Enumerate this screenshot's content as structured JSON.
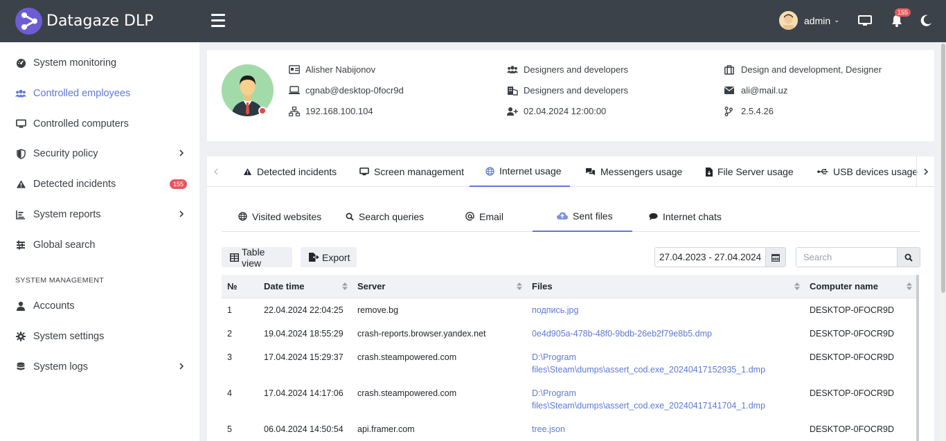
{
  "app": {
    "title": "Datagaze DLP",
    "user_name": "admin",
    "notification_count": "155"
  },
  "sidebar": {
    "items": [
      {
        "label": "System monitoring",
        "icon": "gauge-icon"
      },
      {
        "label": "Controlled employees",
        "icon": "users-icon",
        "active": true
      },
      {
        "label": "Controlled computers",
        "icon": "monitor-icon"
      },
      {
        "label": "Security policy",
        "icon": "shield-icon",
        "has_children": true
      },
      {
        "label": "Detected incidents",
        "icon": "warning-icon",
        "badge": "155"
      },
      {
        "label": "System reports",
        "icon": "chart-icon",
        "has_children": true
      },
      {
        "label": "Global search",
        "icon": "sliders-icon"
      }
    ],
    "section_title": "SYSTEM MANAGEMENT",
    "management_items": [
      {
        "label": "Accounts",
        "icon": "user-icon"
      },
      {
        "label": "System settings",
        "icon": "gear-icon"
      },
      {
        "label": "System logs",
        "icon": "database-icon",
        "has_children": true
      }
    ]
  },
  "profile": {
    "name": "Alisher Nabijonov",
    "computer": "cgnab@desktop-0focr9d",
    "ip": "192.168.100.104",
    "group": "Designers and developers",
    "department": "Designers and developers",
    "added": "02.04.2024 12:00:00",
    "position": "Design and development, Designer",
    "email": "ali@mail.uz",
    "agent_version": "2.5.4.26"
  },
  "tabs": [
    {
      "label": "Detected incidents",
      "icon": "warning-icon"
    },
    {
      "label": "Screen management",
      "icon": "monitor-icon"
    },
    {
      "label": "Internet usage",
      "icon": "globe-icon",
      "active": true
    },
    {
      "label": "Messengers usage",
      "icon": "chat-icon"
    },
    {
      "label": "File Server usage",
      "icon": "file-icon"
    },
    {
      "label": "USB devices usage",
      "icon": "usb-icon"
    }
  ],
  "subtabs": [
    {
      "label": "Visited websites",
      "icon": "globe-icon"
    },
    {
      "label": "Search queries",
      "icon": "search-icon"
    },
    {
      "label": "Email",
      "icon": "at-icon"
    },
    {
      "label": "Sent files",
      "icon": "cloud-upload-icon",
      "active": true
    },
    {
      "label": "Internet chats",
      "icon": "chat-icon"
    }
  ],
  "toolbar": {
    "table_view_label": "Table view",
    "export_label": "Export",
    "date_range": "27.04.2023 - 27.04.2024",
    "search_placeholder": "Search"
  },
  "table": {
    "columns": [
      "№",
      "Date time",
      "Server",
      "Files",
      "Computer name"
    ],
    "rows": [
      {
        "n": "1",
        "datetime": "22.04.2024 22:04:25",
        "server": "remove.bg",
        "files": [
          "подпись.jpg"
        ],
        "computer": "DESKTOP-0FOCR9D"
      },
      {
        "n": "2",
        "datetime": "19.04.2024 18:55:29",
        "server": "crash-reports.browser.yandex.net",
        "files": [
          "0e4d905a-478b-48f0-9bdb-26eb2f79e8b5.dmp"
        ],
        "computer": "DESKTOP-0FOCR9D"
      },
      {
        "n": "3",
        "datetime": "17.04.2024 15:29:37",
        "server": "crash.steampowered.com",
        "files": [
          "D:\\Program",
          "files\\Steam\\dumps\\assert_cod.exe_20240417152935_1.dmp"
        ],
        "computer": "DESKTOP-0FOCR9D"
      },
      {
        "n": "4",
        "datetime": "17.04.2024 14:17:06",
        "server": "crash.steampowered.com",
        "files": [
          "D:\\Program",
          "files\\Steam\\dumps\\assert_cod.exe_20240417141704_1.dmp"
        ],
        "computer": "DESKTOP-0FOCR9D"
      },
      {
        "n": "5",
        "datetime": "06.04.2024 14:50:54",
        "server": "api.framer.com",
        "files": [
          "tree.json"
        ],
        "computer": "DESKTOP-0FOCR9D"
      }
    ]
  },
  "colors": {
    "topbar": "#3c4249",
    "accent": "#5d79d8",
    "badge": "#e9555c",
    "logo": "#6c5dd3"
  }
}
